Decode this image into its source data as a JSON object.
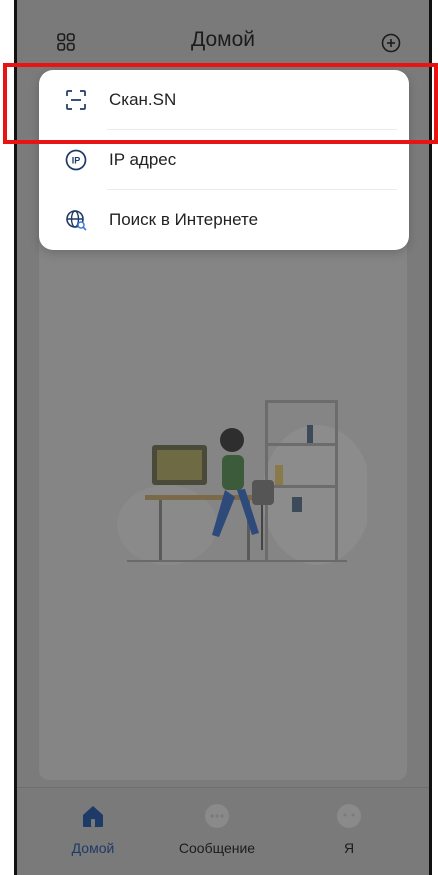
{
  "header": {
    "title": "Домой",
    "left_icon": "apps-grid-icon",
    "right_icon": "add-circle-icon"
  },
  "menu": {
    "items": [
      {
        "label": "Скан.SN",
        "icon": "scan-icon"
      },
      {
        "label": "IP адрес",
        "icon": "ip-icon"
      },
      {
        "label": "Поиск в Интернете",
        "icon": "globe-search-icon"
      }
    ]
  },
  "bottom_nav": {
    "items": [
      {
        "label": "Домой",
        "icon": "home-icon",
        "active": true
      },
      {
        "label": "Сообщение",
        "icon": "message-icon",
        "active": false
      },
      {
        "label": "Я",
        "icon": "profile-icon",
        "active": false
      }
    ]
  },
  "colors": {
    "accent": "#1e3a66",
    "highlight": "#e81313",
    "overlay": "#7b7b7b"
  }
}
